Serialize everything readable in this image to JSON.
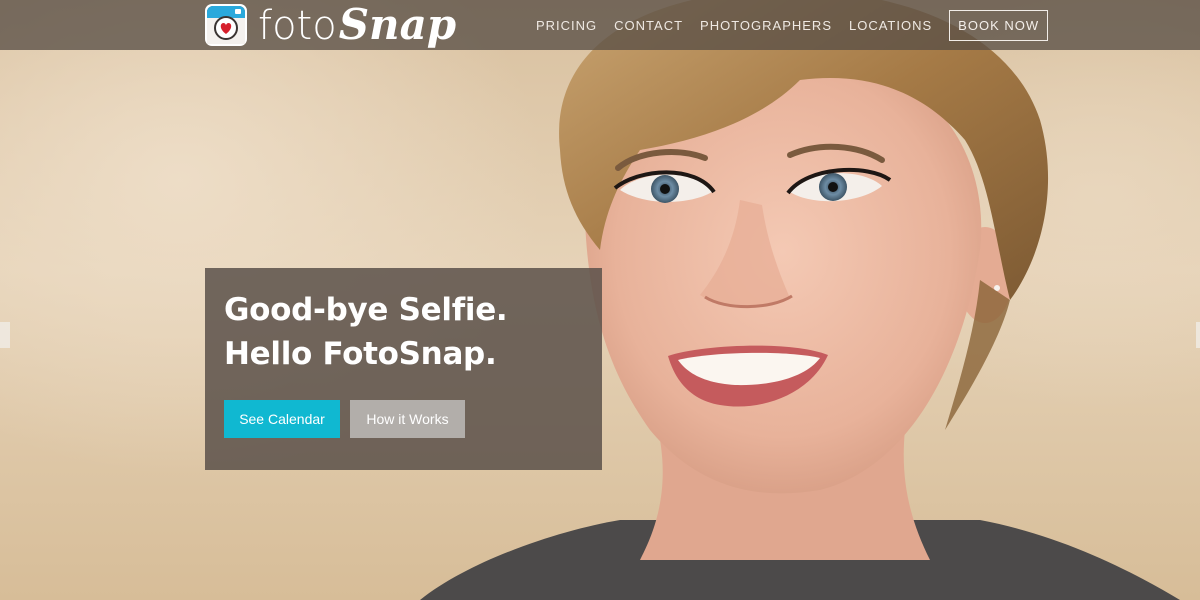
{
  "brand": {
    "name_part1": "foto",
    "name_part2": "Snap",
    "icon": "camera-heart-icon",
    "icon_colors": {
      "top": "#2aa9dc",
      "body": "#ffffff",
      "heart": "#d6202c"
    }
  },
  "nav": {
    "items": [
      {
        "label": "PRICING"
      },
      {
        "label": "CONTACT"
      },
      {
        "label": "PHOTOGRAPHERS"
      },
      {
        "label": "LOCATIONS"
      }
    ],
    "cta": "BOOK NOW"
  },
  "hero": {
    "headline": "Good-bye Selfie. Hello FotoSnap.",
    "primary_button": "See Calendar",
    "secondary_button": "How it Works",
    "colors": {
      "primary": "#10b8d1",
      "secondary": "#b2aeaa",
      "panel": "#5c524a"
    }
  }
}
